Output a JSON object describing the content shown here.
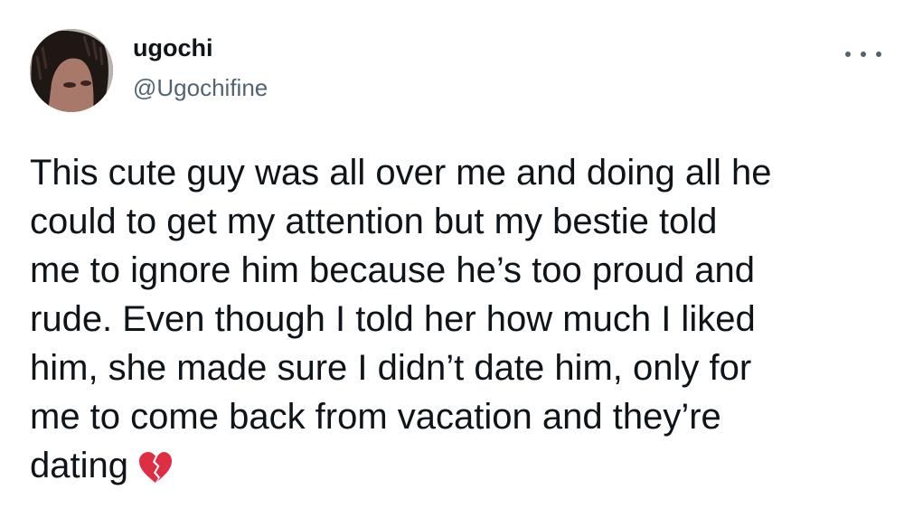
{
  "tweet": {
    "author": {
      "display_name": "ugochi",
      "handle": "@Ugochifine"
    },
    "more_icon": "more-horizontal-icon",
    "lines": [
      "This cute guy was all over me and doing all he",
      "could to get my attention but my bestie told",
      "me to ignore him because he’s too proud and",
      "rude. Even though I told her how much I liked",
      "him, she made sure I didn’t date him, only for",
      "me to come back from vacation and they’re",
      "dating"
    ],
    "emoji": "broken-heart-icon",
    "colors": {
      "text": "#0f1419",
      "secondary": "#536471",
      "emoji": "#dd2e44"
    }
  }
}
